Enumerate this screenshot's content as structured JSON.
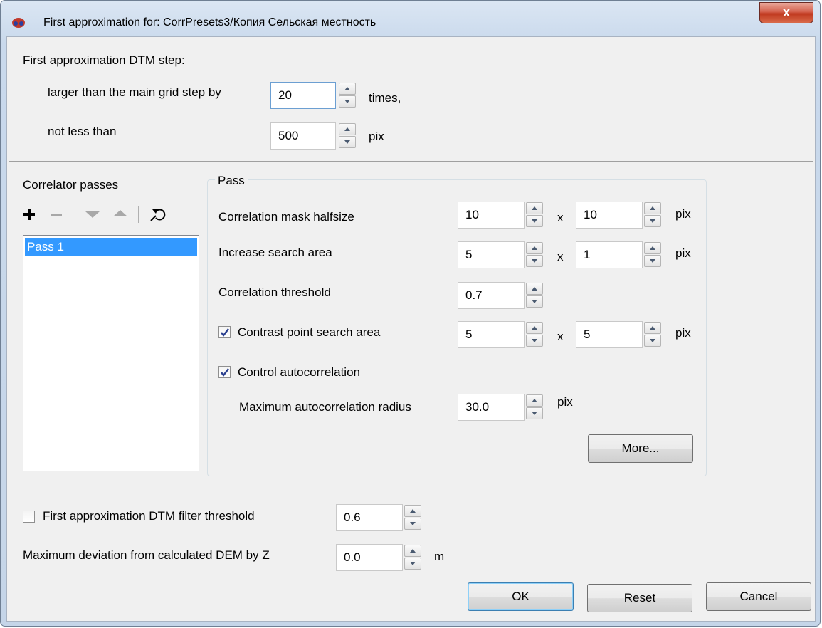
{
  "window": {
    "title": "First approximation for: CorrPresets3/Копия Сельская местность",
    "close_label": "x"
  },
  "dtm_step": {
    "heading": "First approximation DTM step:",
    "larger_label": "larger than the main grid step by",
    "larger_value": "20",
    "larger_unit": "times,",
    "not_less_label": "not less than",
    "not_less_value": "500",
    "not_less_unit": "pix"
  },
  "passes": {
    "label": "Correlator passes",
    "items": [
      "Pass 1"
    ],
    "selected_index": 0,
    "toolbar_icons": [
      "add-icon",
      "remove-icon",
      "move-down-icon",
      "move-up-icon",
      "reset-icon"
    ]
  },
  "pass": {
    "group_title": "Pass",
    "mask_label": "Correlation mask halfsize",
    "mask_x": "10",
    "mask_y": "10",
    "search_label": "Increase search area",
    "search_x": "5",
    "search_y": "1",
    "threshold_label": "Correlation threshold",
    "threshold_value": "0.7",
    "contrast_label": "Contrast point search area",
    "contrast_checked": true,
    "contrast_x": "5",
    "contrast_y": "5",
    "autocorr_label": "Control autocorrelation",
    "autocorr_checked": true,
    "max_autocorr_label": "Maximum autocorrelation radius",
    "max_autocorr_value": "30.0",
    "times_sign": "x",
    "unit_pix": "pix",
    "more_button": "More..."
  },
  "bottom": {
    "filter_label": "First approximation DTM filter threshold",
    "filter_checked": false,
    "filter_value": "0.6",
    "deviation_label": "Maximum deviation from calculated DEM by Z",
    "deviation_value": "0.0",
    "deviation_unit": "m"
  },
  "buttons": {
    "ok": "OK",
    "reset": "Reset",
    "cancel": "Cancel"
  }
}
